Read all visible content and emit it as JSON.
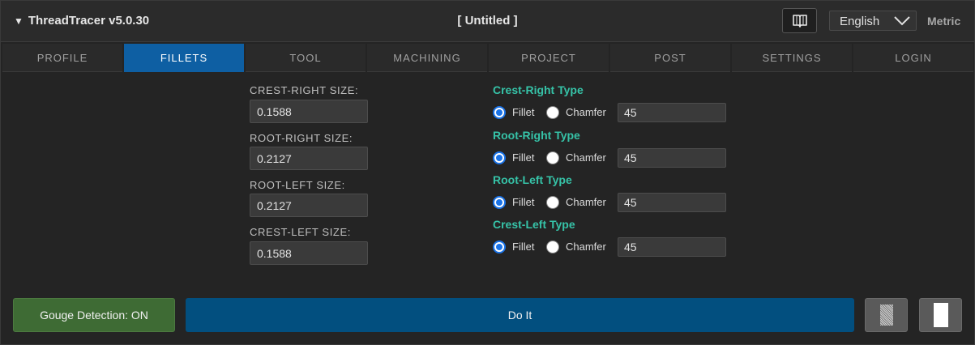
{
  "header": {
    "app_title": "ThreadTracer v5.0.30",
    "collapse_glyph": "▼",
    "document_title": "[ Untitled ]",
    "manual_icon": "book-icon",
    "language": "English",
    "units": "Metric"
  },
  "tabs": [
    {
      "label": "PROFILE",
      "active": false
    },
    {
      "label": "FILLETS",
      "active": true
    },
    {
      "label": "TOOL",
      "active": false
    },
    {
      "label": "MACHINING",
      "active": false
    },
    {
      "label": "PROJECT",
      "active": false
    },
    {
      "label": "POST",
      "active": false
    },
    {
      "label": "SETTINGS",
      "active": false
    },
    {
      "label": "LOGIN",
      "active": false
    }
  ],
  "sizes": [
    {
      "label": "CREST-RIGHT SIZE:",
      "value": "0.1588"
    },
    {
      "label": "ROOT-RIGHT SIZE:",
      "value": "0.2127"
    },
    {
      "label": "ROOT-LEFT SIZE:",
      "value": "0.2127"
    },
    {
      "label": "CREST-LEFT SIZE:",
      "value": "0.1588"
    }
  ],
  "types": [
    {
      "heading": "Crest-Right Type",
      "selected": "Fillet",
      "option_fillet": "Fillet",
      "option_chamfer": "Chamfer",
      "angle": "45"
    },
    {
      "heading": "Root-Right Type",
      "selected": "Fillet",
      "option_fillet": "Fillet",
      "option_chamfer": "Chamfer",
      "angle": "45"
    },
    {
      "heading": "Root-Left Type",
      "selected": "Fillet",
      "option_fillet": "Fillet",
      "option_chamfer": "Chamfer",
      "angle": "45"
    },
    {
      "heading": "Crest-Left Type",
      "selected": "Fillet",
      "option_fillet": "Fillet",
      "option_chamfer": "Chamfer",
      "angle": "45"
    }
  ],
  "footer": {
    "gouge_label": "Gouge Detection: ON",
    "run_label": "Do It",
    "view_icon_1": "shaded-view-icon",
    "view_icon_2": "solid-view-icon"
  },
  "colors": {
    "accent_tab": "#0e5fa3",
    "heading_teal": "#36c3a8",
    "gouge_green": "#3e6b34",
    "run_blue": "#024f7f"
  }
}
